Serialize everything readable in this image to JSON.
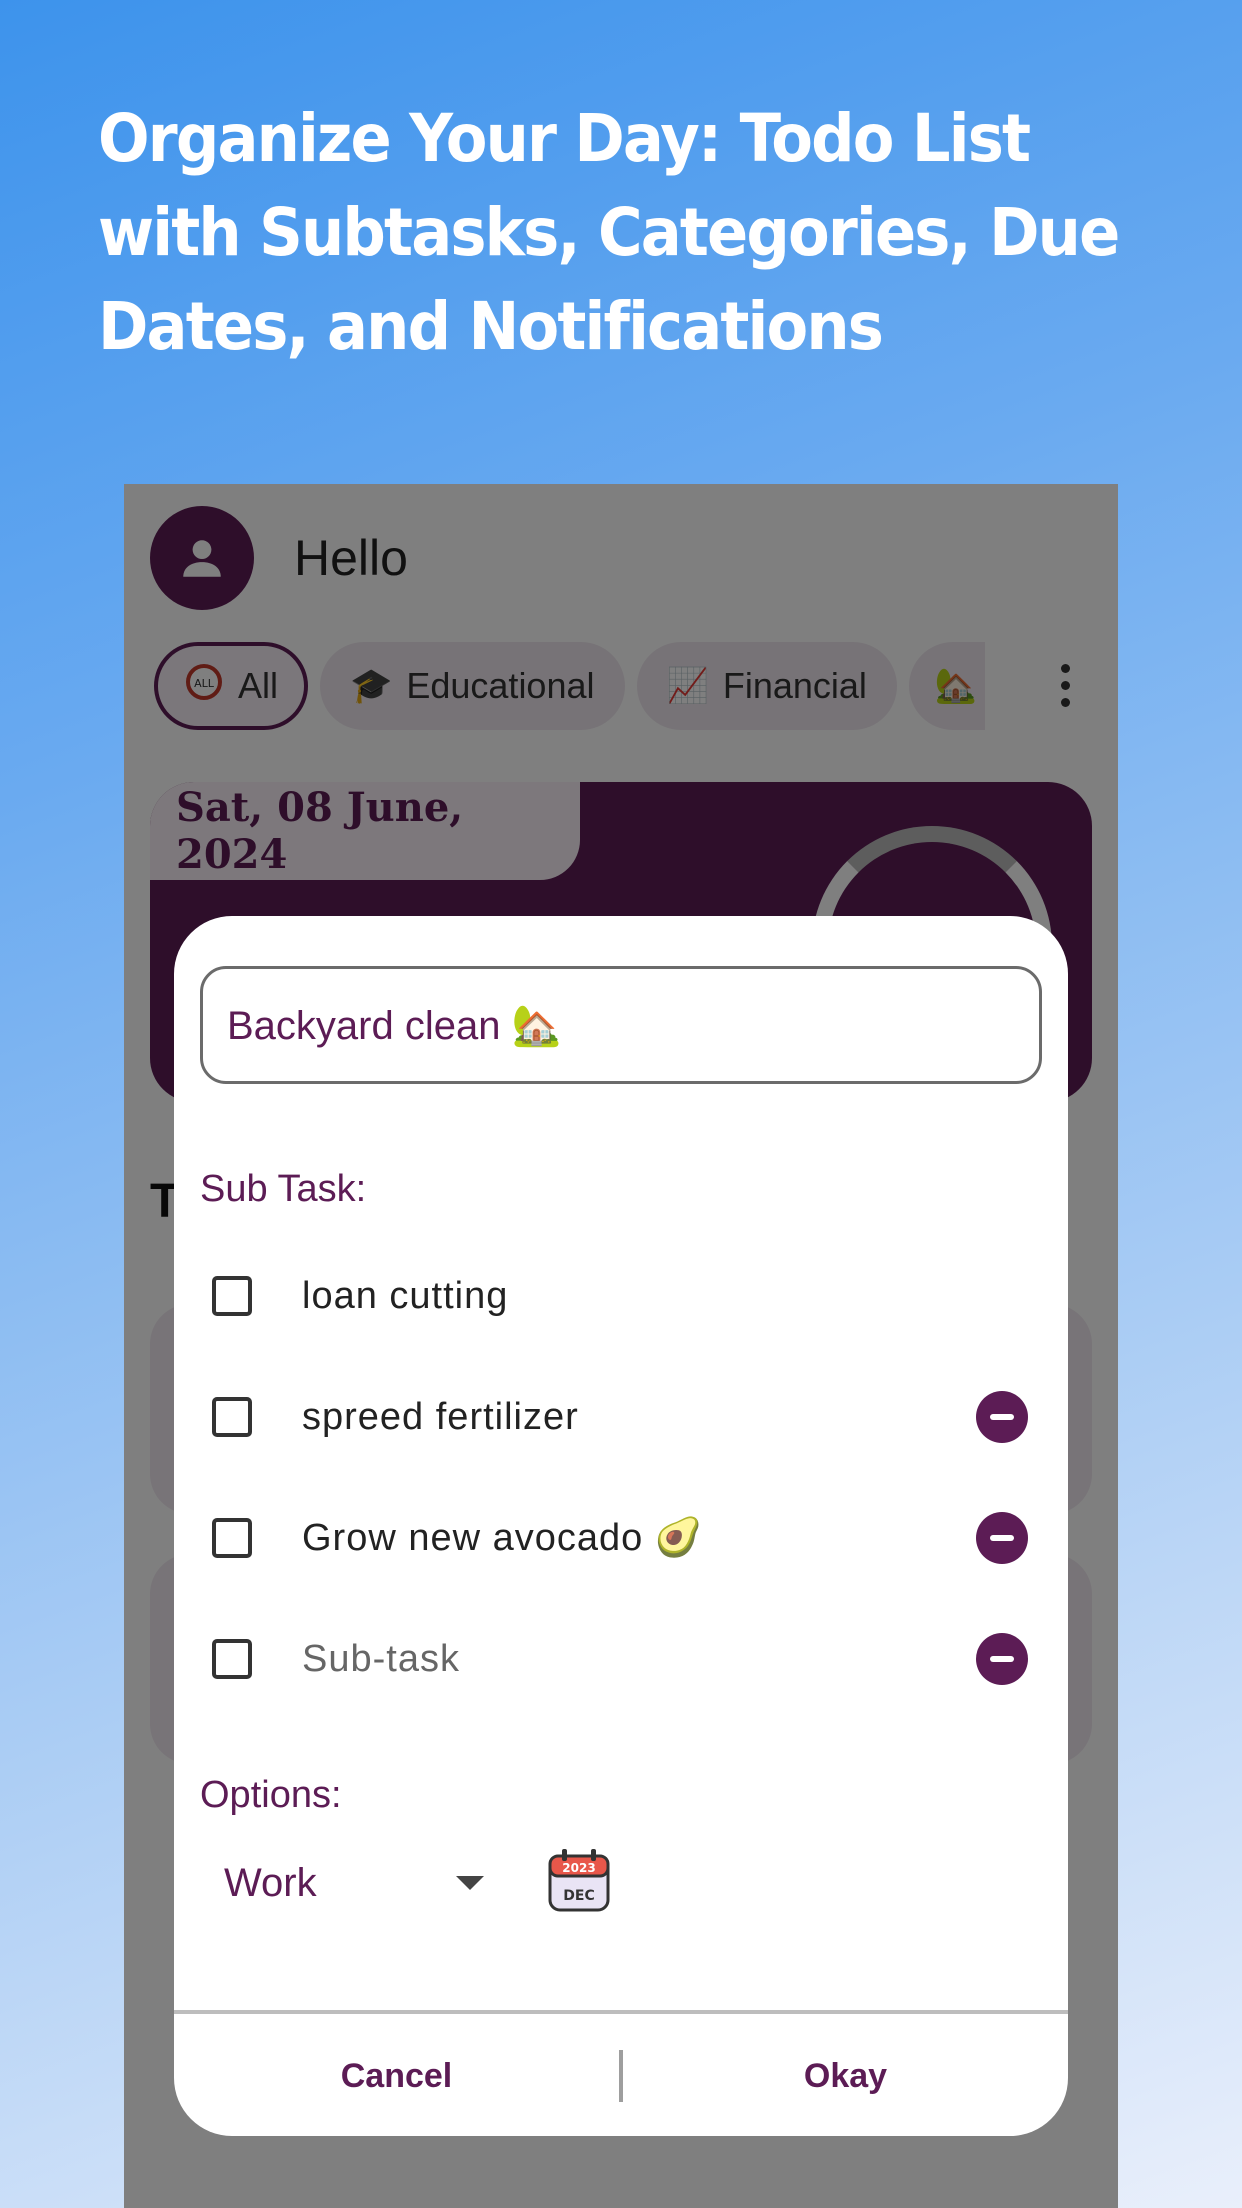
{
  "headline": "Organize Your Day: Todo List with Subtasks, Categories, Due Dates, and Notifications",
  "app": {
    "greeting": "Hello",
    "categories": [
      {
        "label": "All",
        "icon": "all-icon",
        "active": true
      },
      {
        "label": "Educational",
        "icon": "graduation-cap-icon"
      },
      {
        "label": "Financial",
        "icon": "chart-icon"
      },
      {
        "label": "",
        "icon": "house-icon"
      }
    ],
    "date": "Sat, 08 June, 2024",
    "section_title_partial": "T"
  },
  "dialog": {
    "title_value": "Backyard clean 🏡",
    "subtask_heading": "Sub Task:",
    "subtasks": [
      {
        "text": "loan cutting",
        "removable": false
      },
      {
        "text": "spreed fertilizer",
        "removable": true
      },
      {
        "text": "Grow new avocado 🥑",
        "removable": true
      }
    ],
    "subtask_placeholder": "Sub-task",
    "options_heading": "Options:",
    "category_value": "Work",
    "calendar": {
      "year": "2023",
      "month": "DEC"
    },
    "cancel_label": "Cancel",
    "okay_label": "Okay"
  },
  "colors": {
    "primary": "#5c1c55",
    "background_top": "#3d93ec",
    "background_bottom": "#e9effb"
  }
}
